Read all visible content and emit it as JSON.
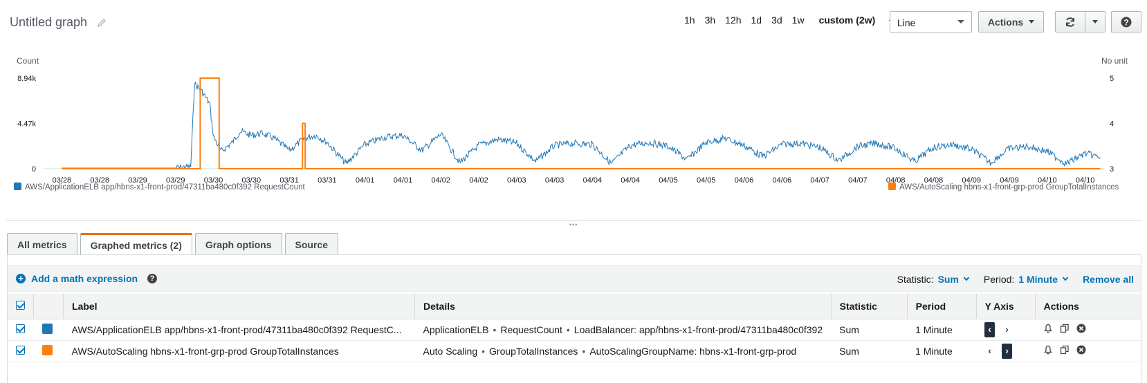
{
  "header": {
    "title": "Untitled graph",
    "ranges": [
      "1h",
      "3h",
      "12h",
      "1d",
      "3d",
      "1w"
    ],
    "custom_range": "custom (2w)",
    "graph_type": "Line",
    "actions_label": "Actions"
  },
  "chart_data": {
    "type": "line",
    "ylabel_left": "Count",
    "ylabel_right": "No unit",
    "left_ticks": [
      "8.94k",
      "4.47k",
      "0"
    ],
    "right_ticks": [
      "5",
      "4",
      "3"
    ],
    "ylim_left": [
      0,
      8940
    ],
    "ylim_right": [
      3,
      5
    ],
    "x_ticks": [
      "03/28",
      "03/28",
      "03/29",
      "03/29",
      "03/30",
      "03/30",
      "03/31",
      "03/31",
      "04/01",
      "04/01",
      "04/02",
      "04/02",
      "04/03",
      "04/03",
      "04/04",
      "04/04",
      "04/05",
      "04/05",
      "04/06",
      "04/06",
      "04/07",
      "04/07",
      "04/08",
      "04/08",
      "04/09",
      "04/09",
      "04/10",
      "04/10"
    ],
    "grid": false,
    "legend_placement": "bottom",
    "series": [
      {
        "name": "AWS/ApplicationELB app/hbns-x1-front-prod/47311ba480c0f392 RequestCount",
        "axis": "left",
        "color": "#1f77b4",
        "x_index": [
          0,
          3,
          3.4,
          3.5,
          3.7,
          3.9,
          4.0,
          4.2,
          4.5,
          4.7,
          5.0,
          5.3,
          5.6,
          6.0,
          6.4,
          6.7,
          7.0,
          7.5,
          8.0,
          8.5,
          9.0,
          9.5,
          10.0,
          10.5,
          11.0,
          11.5,
          12.0,
          12.5,
          13.0,
          13.5,
          14.0,
          14.5,
          15.0,
          15.5,
          16.0,
          16.5,
          17.0,
          17.5,
          18.0,
          18.5,
          19.0,
          19.5,
          20.0,
          20.5,
          21.0,
          21.5,
          22.0,
          22.5,
          23.0,
          23.5,
          24.0,
          24.5,
          25.0,
          25.5,
          26.0,
          26.5,
          27.0,
          27.4
        ],
        "values": [
          60,
          60,
          200,
          8400,
          7600,
          6400,
          3200,
          1700,
          2600,
          3700,
          3300,
          3500,
          3000,
          1800,
          3000,
          3300,
          2600,
          500,
          2400,
          3100,
          3300,
          1800,
          3400,
          600,
          2300,
          2900,
          2500,
          700,
          2300,
          2500,
          2400,
          500,
          2300,
          2600,
          2200,
          900,
          2600,
          3000,
          2300,
          1200,
          2400,
          2500,
          2100,
          800,
          2200,
          2500,
          2000,
          700,
          2100,
          2400,
          1900,
          600,
          2000,
          2200,
          1700,
          500,
          1500,
          1100
        ]
      },
      {
        "name": "AWS/AutoScaling hbns-x1-front-grp-prod GroupTotalInstances",
        "axis": "right",
        "color": "#ff7f0e",
        "x_index": [
          0,
          3.65,
          3.65,
          4.15,
          4.15,
          6.35,
          6.35,
          6.42,
          6.42,
          27.4
        ],
        "values": [
          3,
          3,
          5,
          5,
          3,
          3,
          4,
          4,
          3,
          3
        ]
      }
    ]
  },
  "tabs": [
    "All metrics",
    "Graphed metrics (2)",
    "Graph options",
    "Source"
  ],
  "toolbar": {
    "math_label": "Add a math expression",
    "statistic_label": "Statistic:",
    "statistic_value": "Sum",
    "period_label": "Period:",
    "period_value": "1 Minute",
    "remove_all": "Remove all"
  },
  "table": {
    "headers": [
      "Label",
      "Details",
      "Statistic",
      "Period",
      "Y Axis",
      "Actions"
    ],
    "rows": [
      {
        "color": "#1f77b4",
        "label": "AWS/ApplicationELB app/hbns-x1-front-prod/47311ba480c0f392 RequestC...",
        "details": [
          "ApplicationELB",
          "RequestCount",
          "LoadBalancer: app/hbns-x1-front-prod/47311ba480c0f392"
        ],
        "statistic": "Sum",
        "period": "1 Minute",
        "y_axis": "left"
      },
      {
        "color": "#ff7f0e",
        "label": "AWS/AutoScaling hbns-x1-front-grp-prod GroupTotalInstances",
        "details": [
          "Auto Scaling",
          "GroupTotalInstances",
          "AutoScalingGroupName: hbns-x1-front-grp-prod"
        ],
        "statistic": "Sum",
        "period": "1 Minute",
        "y_axis": "right"
      }
    ]
  },
  "icons": {
    "edit": "pencil-icon",
    "refresh": "refresh-icon",
    "help": "help-icon",
    "alarm": "bell-icon",
    "copy": "copy-icon",
    "remove": "close-icon"
  }
}
